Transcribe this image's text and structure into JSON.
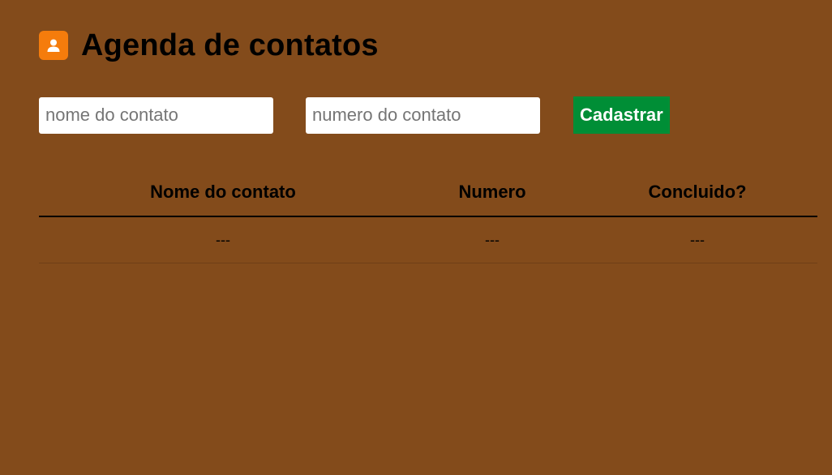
{
  "header": {
    "icon": "user-icon",
    "icon_color": "#f57c0c",
    "title": "Agenda de contatos"
  },
  "form": {
    "name_input": {
      "value": "",
      "placeholder": "nome do contato"
    },
    "number_input": {
      "value": "",
      "placeholder": "numero do contato"
    },
    "submit_label": "Cadastrar",
    "submit_color": "#008e36"
  },
  "table": {
    "headers": [
      "Nome do contato",
      "Numero",
      "Concluido?"
    ],
    "rows": [
      [
        "---",
        "---",
        "---"
      ]
    ]
  },
  "colors": {
    "background": "#834b1b"
  }
}
